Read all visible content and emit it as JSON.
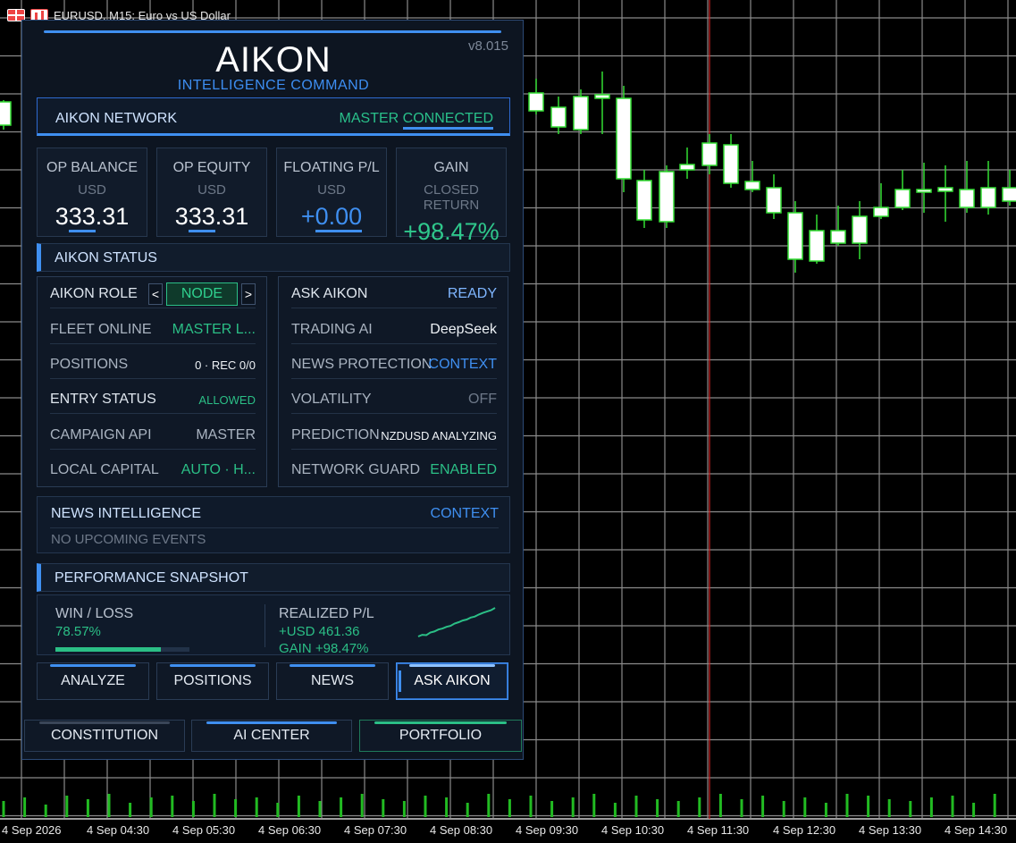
{
  "window": {
    "title": "EURUSD, M15:  Euro vs US Dollar"
  },
  "chart_data": {
    "type": "candlestick",
    "symbol": "EURUSD",
    "timeframe": "M15",
    "x_tick_labels": [
      "4 Sep 2026",
      "4 Sep 04:30",
      "4 Sep 05:30",
      "4 Sep 06:30",
      "4 Sep 07:30",
      "4 Sep 08:30",
      "4 Sep 09:30",
      "4 Sep 10:30",
      "4 Sep 11:30",
      "4 Sep 12:30",
      "4 Sep 13:30",
      "4 Sep 14:30"
    ],
    "grid": true,
    "colors": {
      "bull": "#ffffff",
      "bear": "#ffffff",
      "wick": "#33dd33",
      "volume": "#22bb22",
      "cursor_line": "#cc2222"
    }
  },
  "panel": {
    "version": "v8.015",
    "brand": "AIKON",
    "subtitle": "INTELLIGENCE COMMAND",
    "network": {
      "label": "AIKON NETWORK",
      "status_prefix": "MASTER ",
      "status_main": "CONNECTED"
    },
    "cards": [
      {
        "title": "OP BALANCE",
        "unit": "USD",
        "value_pre": "3",
        "value_mid": "33",
        "value_post": ".31"
      },
      {
        "title": "OP EQUITY",
        "unit": "USD",
        "value_pre": "3",
        "value_mid": "33",
        "value_post": ".31"
      },
      {
        "title": "FLOATING P/L",
        "unit": "USD",
        "value_pre": "+",
        "value_mid": "0.00",
        "value_post": ""
      },
      {
        "title": "GAIN",
        "unit": "CLOSED RETURN",
        "value_pre": "+98.",
        "value_mid": "47",
        "value_post": "%"
      }
    ],
    "status": {
      "header": "AIKON STATUS",
      "left": {
        "role_label": "AIKON ROLE",
        "role_value": "NODE",
        "prev": "<",
        "next": ">",
        "rows": [
          {
            "k": "FLEET ONLINE",
            "v": "MASTER L..."
          },
          {
            "k": "POSITIONS",
            "v": "0 · REC 0/0"
          },
          {
            "k": "ENTRY STATUS",
            "v": "ALLOWED"
          },
          {
            "k": "CAMPAIGN API",
            "v": "MASTER"
          },
          {
            "k": "LOCAL CAPITAL",
            "v": "AUTO · H..."
          }
        ]
      },
      "right": {
        "rows": [
          {
            "k": "ASK AIKON",
            "v": "READY"
          },
          {
            "k": "TRADING AI",
            "v": "DeepSeek"
          },
          {
            "k": "NEWS PROTECTION",
            "v": "CONTEXT"
          },
          {
            "k": "VOLATILITY",
            "v": "OFF"
          },
          {
            "k": "PREDICTION",
            "v": "NZDUSD ANALYZING"
          },
          {
            "k": "NETWORK GUARD",
            "v": "ENABLED"
          }
        ]
      }
    },
    "news": {
      "label": "NEWS INTELLIGENCE",
      "mode": "CONTEXT",
      "empty": "NO UPCOMING EVENTS"
    },
    "performance": {
      "header": "PERFORMANCE SNAPSHOT",
      "winloss_label": "WIN / LOSS",
      "winloss_value": "78.57%",
      "winloss_fraction": 0.7857,
      "realized_label": "REALIZED P/L",
      "realized_value": "+USD 461.36",
      "gain": "GAIN +98.47%",
      "sparkline": [
        0,
        0.5,
        0.4,
        1.2,
        1.5,
        2.1,
        2.4,
        2.9,
        3.2,
        3.9,
        4.3,
        4.8,
        5.1,
        5.7,
        6.0,
        6.6,
        7.1,
        7.5,
        7.9,
        8.6
      ]
    },
    "buttons": [
      "ANALYZE",
      "POSITIONS",
      "NEWS",
      "ASK AIKON"
    ],
    "footer": [
      "CONSTITUTION",
      "AI CENTER",
      "PORTFOLIO"
    ]
  }
}
